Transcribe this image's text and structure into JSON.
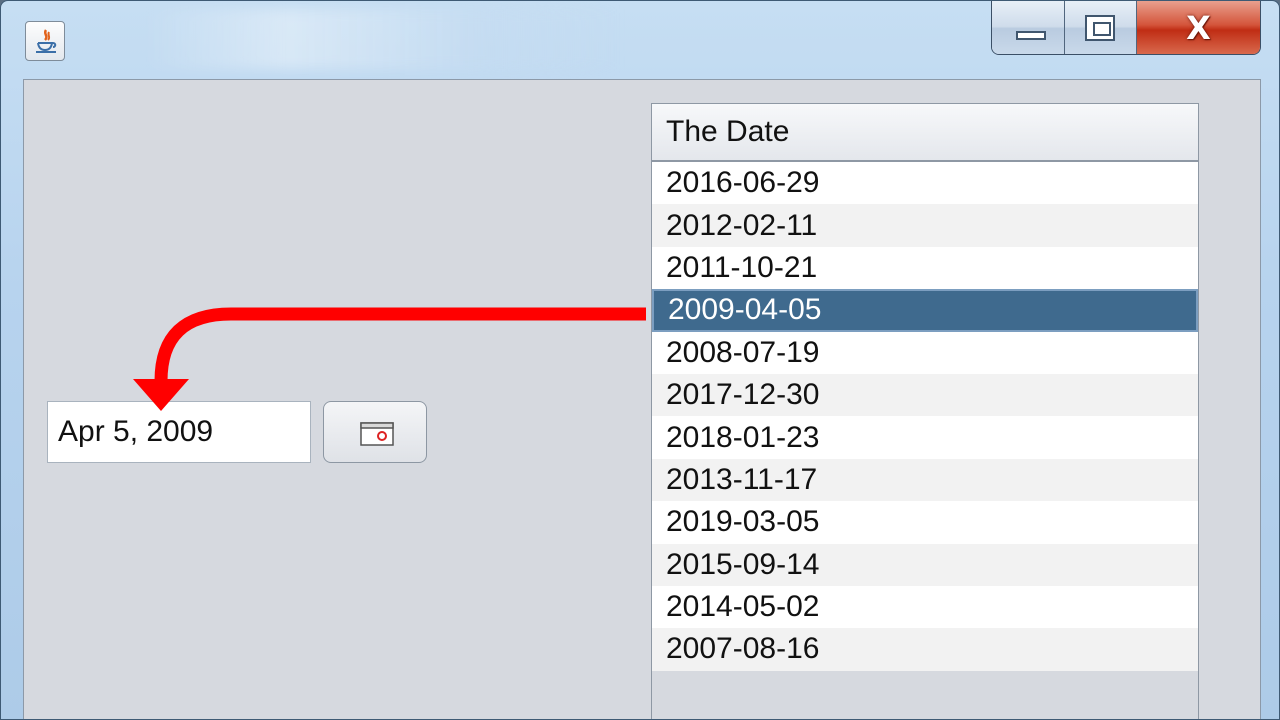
{
  "window": {
    "controls": {
      "minimize": "minimize",
      "maximize": "maximize",
      "close": "close"
    }
  },
  "date_picker": {
    "value": "Apr 5, 2009",
    "button_icon": "calendar-icon"
  },
  "table": {
    "header": "The Date",
    "rows": [
      "2016-06-29",
      "2012-02-11",
      "2011-10-21",
      "2009-04-05",
      "2008-07-19",
      "2017-12-30",
      "2018-01-23",
      "2013-11-17",
      "2019-03-05",
      "2015-09-14",
      "2014-05-02",
      "2007-08-16"
    ],
    "selected_row": "2009-04-05"
  },
  "annotation": {
    "arrow_color": "#ff0000"
  }
}
